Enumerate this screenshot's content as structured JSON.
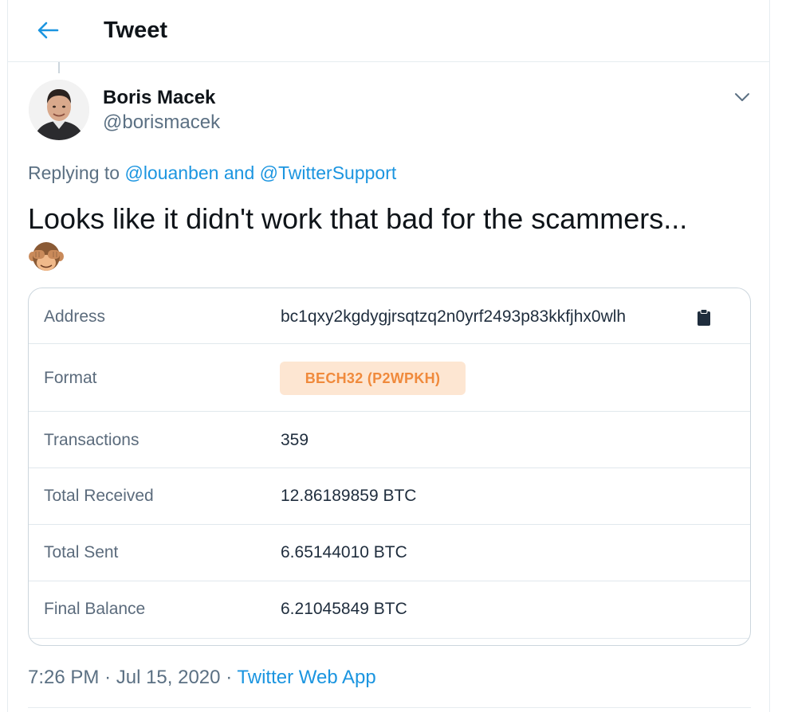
{
  "header": {
    "title": "Tweet"
  },
  "tweet": {
    "author_name": "Boris Macek",
    "author_handle": "@borismacek",
    "replying_prefix": "Replying to",
    "replying_to_1": "@louanben",
    "replying_and": "and",
    "replying_to_2": "@TwitterSupport",
    "text": "Looks like it didn't work that bad for the scammers...",
    "emoji": "🙈",
    "time": "7:26 PM",
    "separator": "·",
    "date": "Jul 15, 2020",
    "source": "Twitter Web App"
  },
  "card": {
    "rows": [
      {
        "label": "Address",
        "value": "bc1qxy2kgdygjrsqtzq2n0yrf2493p83kkfjhx0wlh"
      },
      {
        "label": "Format",
        "value": "BECH32 (P2WPKH)"
      },
      {
        "label": "Transactions",
        "value": "359"
      },
      {
        "label": "Total Received",
        "value": "12.86189859 BTC"
      },
      {
        "label": "Total Sent",
        "value": "6.65144010 BTC"
      },
      {
        "label": "Final Balance",
        "value": "6.21045849 BTC"
      }
    ]
  },
  "icons": {
    "back": "arrow-left-icon",
    "caret": "chevron-down-icon",
    "copy": "clipboard-icon"
  },
  "colors": {
    "link": "#1b95e0",
    "secondary_text": "#5b7083",
    "badge_bg": "#fde6d2",
    "badge_text": "#f08a3c"
  }
}
